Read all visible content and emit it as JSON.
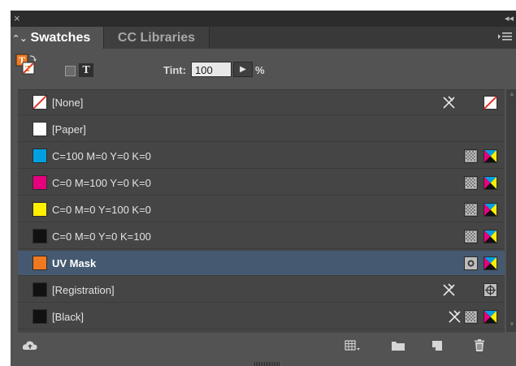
{
  "panel": {
    "close_glyph": "×",
    "collapse_glyph": "◂◂",
    "tabs": [
      {
        "label": "Swatches",
        "active": true
      },
      {
        "label": "CC Libraries",
        "active": false
      }
    ],
    "menu_icon": "panel-menu-icon"
  },
  "toolbar": {
    "formatting_text_label": "T",
    "tint_label": "Tint:",
    "tint_value": "100",
    "tint_unit": "%"
  },
  "swatches": [
    {
      "name": "[None]",
      "color": "none",
      "selected": false,
      "icons": [
        "not-editable",
        "none"
      ]
    },
    {
      "name": "[Paper]",
      "color": "#ffffff",
      "selected": false,
      "icons": []
    },
    {
      "name": "C=100 M=0 Y=0 K=0",
      "color": "#00a0e3",
      "selected": false,
      "icons": [
        "process",
        "cmyk"
      ]
    },
    {
      "name": "C=0 M=100 Y=0 K=0",
      "color": "#e6007e",
      "selected": false,
      "icons": [
        "process",
        "cmyk"
      ]
    },
    {
      "name": "C=0 M=0 Y=100 K=0",
      "color": "#fff000",
      "selected": false,
      "icons": [
        "process",
        "cmyk"
      ]
    },
    {
      "name": "C=0 M=0 Y=0 K=100",
      "color": "#111111",
      "selected": false,
      "icons": [
        "process",
        "cmyk"
      ]
    },
    {
      "name": "UV Mask",
      "color": "#f0791f",
      "selected": true,
      "icons": [
        "spot",
        "cmyk"
      ]
    },
    {
      "name": "[Registration]",
      "color": "#111111",
      "selected": false,
      "icons": [
        "not-editable",
        "registration"
      ]
    },
    {
      "name": "[Black]",
      "color": "#111111",
      "selected": false,
      "icons": [
        "not-editable",
        "process",
        "cmyk"
      ]
    }
  ],
  "colors": {
    "panel_bg": "#535353",
    "list_bg": "#454545",
    "selected_row": "#455a70"
  }
}
